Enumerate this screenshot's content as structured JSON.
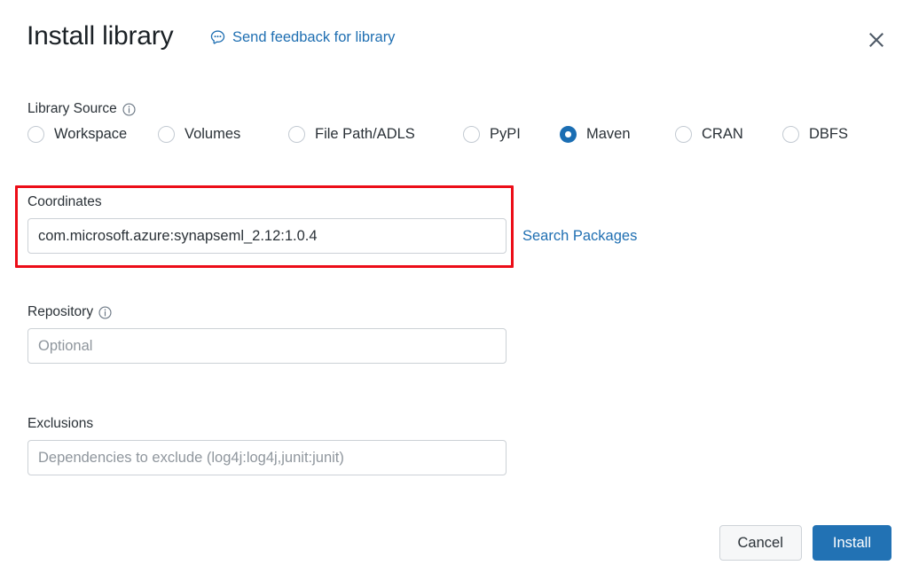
{
  "header": {
    "title": "Install library",
    "feedback_link": "Send feedback for library",
    "feedback_icon": "comment-bubble-icon",
    "close_icon": "close-icon"
  },
  "library_source": {
    "label": "Library Source",
    "info_icon": "info-icon",
    "selected": "Maven",
    "options": [
      {
        "label": "Workspace",
        "selected": false
      },
      {
        "label": "Volumes",
        "selected": false
      },
      {
        "label": "File Path/ADLS",
        "selected": false
      },
      {
        "label": "PyPI",
        "selected": false
      },
      {
        "label": "Maven",
        "selected": true
      },
      {
        "label": "CRAN",
        "selected": false
      },
      {
        "label": "DBFS",
        "selected": false
      }
    ]
  },
  "fields": {
    "coordinates": {
      "label": "Coordinates",
      "value": "com.microsoft.azure:synapseml_2.12:1.0.4",
      "placeholder": "",
      "has_info_icon": false
    },
    "repository": {
      "label": "Repository",
      "value": "",
      "placeholder": "Optional",
      "has_info_icon": true,
      "info_icon": "info-icon"
    },
    "exclusions": {
      "label": "Exclusions",
      "value": "",
      "placeholder": "Dependencies to exclude (log4j:log4j,junit:junit)",
      "has_info_icon": false
    }
  },
  "links": {
    "search_packages": "Search Packages"
  },
  "footer": {
    "cancel_label": "Cancel",
    "install_label": "Install"
  },
  "annotation": {
    "type": "red-rectangle-highlight",
    "target": "coordinates-field",
    "color": "#ec0d18"
  },
  "colors": {
    "accent_blue": "#2272b4",
    "link_blue": "#1f6fb2",
    "radio_selected": "#1b6eb3",
    "text": "#1b2126",
    "placeholder": "#8f969d",
    "border": "#ccd1d6",
    "annotation_red": "#ec0d18"
  }
}
